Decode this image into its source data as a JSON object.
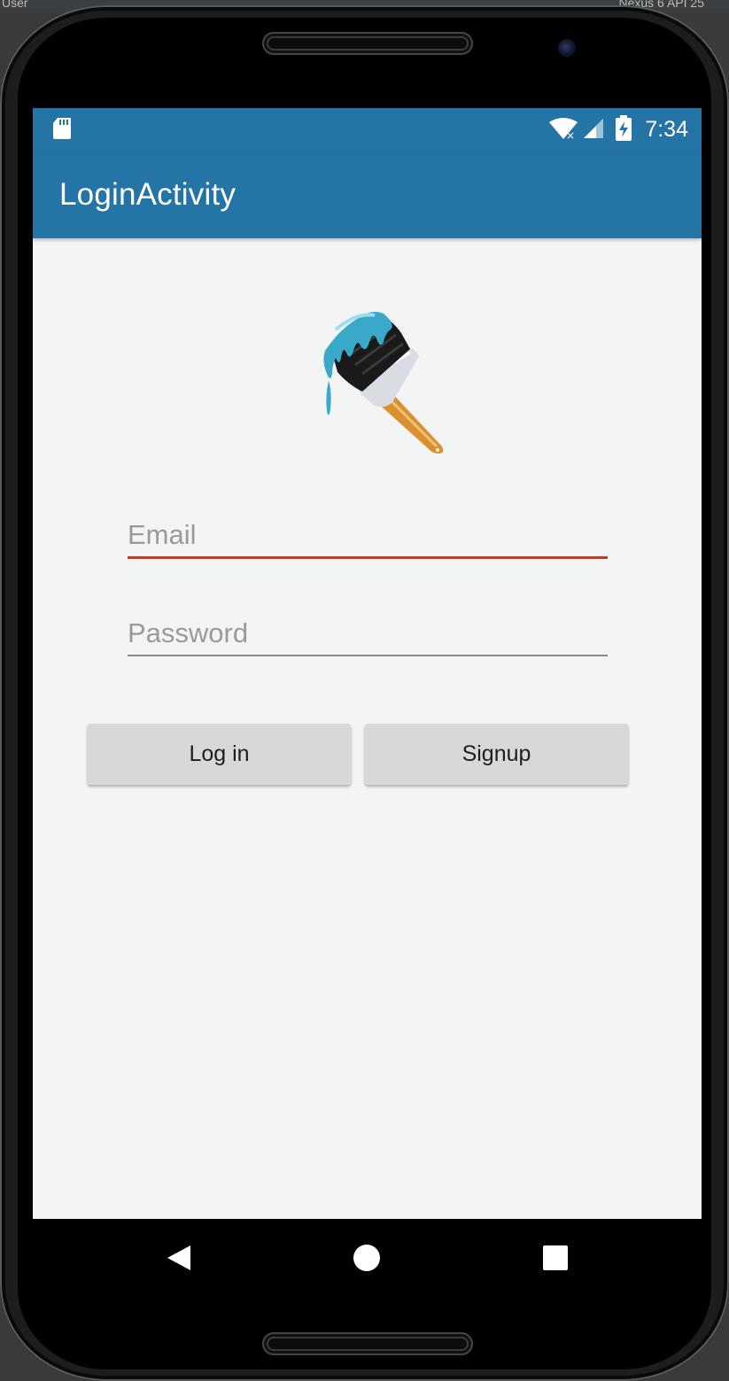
{
  "ide": {
    "left_text": "User",
    "right_text": "Nexus 6 API 25"
  },
  "status_bar": {
    "time": "7:34",
    "icons": [
      "sd-card-icon",
      "wifi-icon",
      "signal-icon",
      "battery-charging-icon"
    ]
  },
  "app_bar": {
    "title": "LoginActivity"
  },
  "logo": {
    "icon": "paintbrush-icon",
    "colors": {
      "paint": "#3aa9c9",
      "bristles": "#1a1a1a",
      "ferrule": "#d9dde3",
      "handle": "#d9912f"
    }
  },
  "form": {
    "email": {
      "placeholder": "Email",
      "value": "",
      "focused": true
    },
    "password": {
      "placeholder": "Password",
      "value": ""
    }
  },
  "buttons": {
    "login_label": "Log in",
    "signup_label": "Signup"
  },
  "nav_bar": {
    "icons": [
      "back-icon",
      "home-icon",
      "recents-icon"
    ]
  },
  "colors": {
    "primary": "#2574a6",
    "accent_underline": "#c0392b",
    "screen_bg": "#f3f4f4",
    "button_bg": "#d8d8d8"
  }
}
